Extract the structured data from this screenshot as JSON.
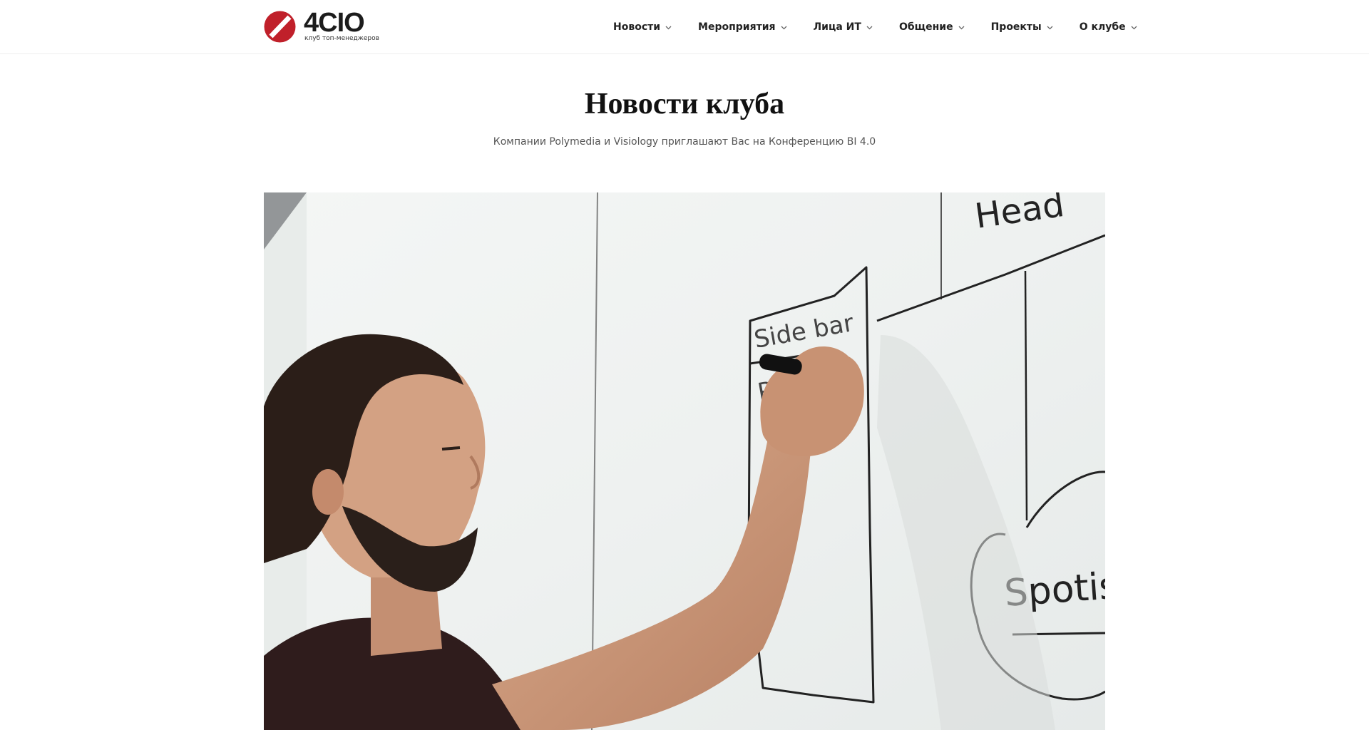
{
  "header": {
    "logo": {
      "name": "4CIO",
      "tagline": "клуб топ-менеджеров"
    },
    "nav": [
      {
        "label": "Новости",
        "icon": "chevron-down-icon"
      },
      {
        "label": "Мероприятия",
        "icon": "chevron-down-icon"
      },
      {
        "label": "Лица ИТ",
        "icon": "chevron-down-icon"
      },
      {
        "label": "Общение",
        "icon": "chevron-down-icon"
      },
      {
        "label": "Проекты",
        "icon": "chevron-down-icon"
      },
      {
        "label": "О клубе",
        "icon": "chevron-down-icon"
      }
    ]
  },
  "main": {
    "title": "Новости клуба",
    "subtitle": "Компании Polymedia и Visiology приглашают Вас на Конференцию BI 4.0",
    "hero_image": {
      "whiteboard_text": [
        "Head",
        "Side bar",
        "Pho",
        "Spotish"
      ]
    }
  },
  "colors": {
    "brand": "#c0202a",
    "text": "#222222"
  }
}
